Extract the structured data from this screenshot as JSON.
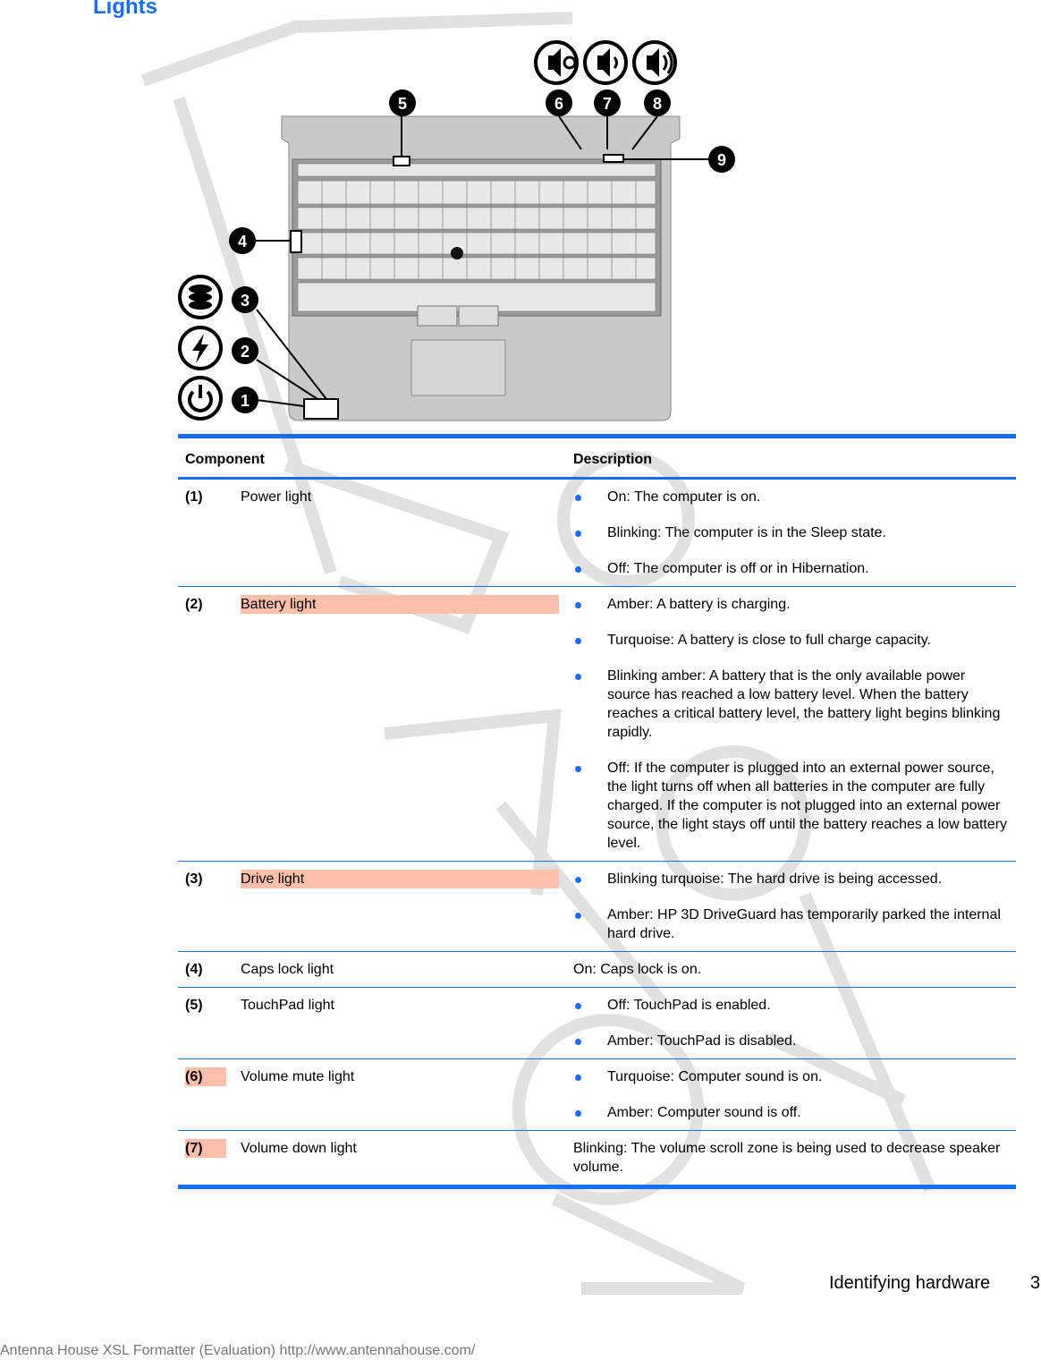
{
  "title": "Lights",
  "figure": {
    "callouts": [
      "1",
      "2",
      "3",
      "4",
      "5",
      "6",
      "7",
      "8",
      "9"
    ],
    "icons": [
      "power-icon",
      "battery-lightning-icon",
      "drive-icon",
      "volume-mute-icon",
      "volume-down-icon",
      "volume-up-icon"
    ]
  },
  "table": {
    "headers": {
      "component": "Component",
      "description": "Description"
    },
    "rows": [
      {
        "num": "(1)",
        "component": "Power light",
        "highlight_component": false,
        "highlight_num": false,
        "items": [
          "On: The computer is on.",
          "Blinking: The computer is in the Sleep state.",
          "Off: The computer is off or in Hibernation."
        ]
      },
      {
        "num": "(2)",
        "component": "Battery light",
        "highlight_component": true,
        "highlight_num": false,
        "items": [
          "Amber: A battery is charging.",
          "Turquoise: A battery is close to full charge capacity.",
          "Blinking amber: A battery that is the only available power source has reached a low battery level. When the battery reaches a critical battery level, the battery light begins blinking rapidly.",
          "Off: If the computer is plugged into an external power source, the light turns off when all batteries in the computer are fully charged. If the computer is not plugged into an external power source, the light stays off until the battery reaches a low battery level."
        ]
      },
      {
        "num": "(3)",
        "component": "Drive light",
        "highlight_component": true,
        "highlight_num": false,
        "items": [
          "Blinking turquoise: The hard drive is being accessed.",
          "Amber: HP 3D DriveGuard has temporarily parked the internal hard drive."
        ]
      },
      {
        "num": "(4)",
        "component": "Caps lock light",
        "highlight_component": false,
        "highlight_num": false,
        "text": "On: Caps lock is on."
      },
      {
        "num": "(5)",
        "component": "TouchPad light",
        "highlight_component": false,
        "highlight_num": false,
        "items": [
          "Off: TouchPad is enabled.",
          "Amber: TouchPad is disabled."
        ]
      },
      {
        "num": "(6)",
        "component": "Volume mute light",
        "highlight_component": false,
        "highlight_num": true,
        "items": [
          "Turquoise: Computer sound is on.",
          "Amber: Computer sound is off."
        ]
      },
      {
        "num": "(7)",
        "component": "Volume down light",
        "highlight_component": false,
        "highlight_num": true,
        "text": "Blinking: The volume scroll zone is being used to decrease speaker volume."
      }
    ]
  },
  "footer": {
    "section": "Identifying hardware",
    "page": "3"
  },
  "formatter_notice": "Antenna House XSL Formatter (Evaluation)  http://www.antennahouse.com/",
  "colors": {
    "accent": "#1a6ef5",
    "highlight": "#ffbfaa",
    "watermark": "#d9d9d9"
  }
}
